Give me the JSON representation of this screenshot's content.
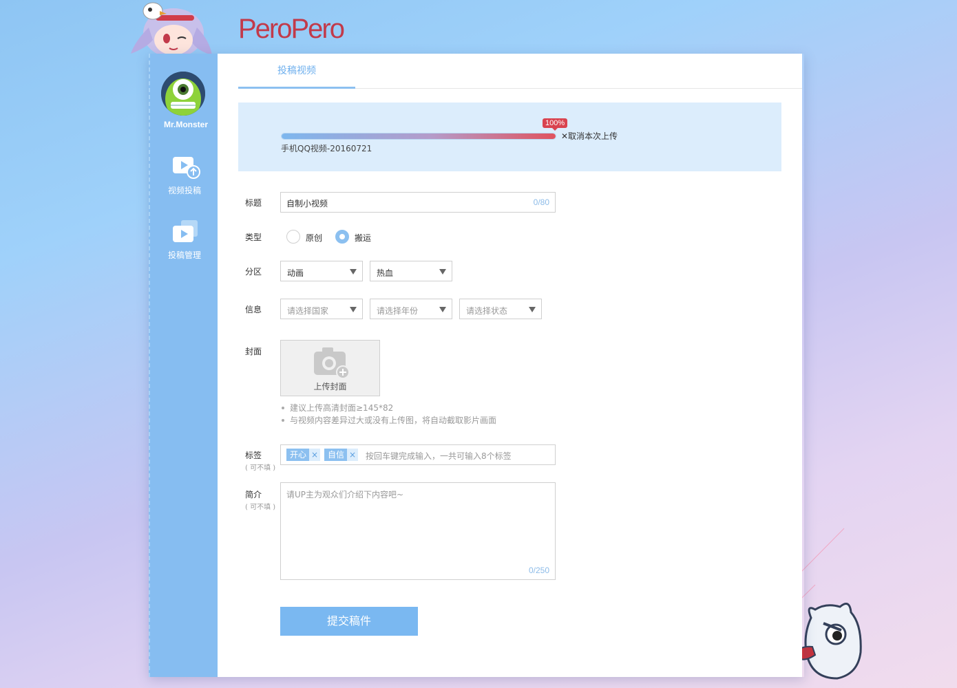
{
  "brand": {
    "logo_text_1": "Pero",
    "logo_text_2": "Pero"
  },
  "sidebar": {
    "username": "Mr.Monster",
    "items": [
      {
        "label": "视频投稿",
        "icon": "video-upload-icon"
      },
      {
        "label": "投稿管理",
        "icon": "video-manage-icon"
      }
    ]
  },
  "tabs": [
    {
      "label": "投稿视频",
      "active": true
    }
  ],
  "upload": {
    "progress": 100,
    "progress_label": "100%",
    "cancel_label": "✕取消本次上传",
    "file_name": "手机QQ视频-20160721"
  },
  "form": {
    "title": {
      "label": "标题",
      "value": "自制小视频",
      "counter": "0/80"
    },
    "type": {
      "label": "类型",
      "options": [
        "原创",
        "搬运"
      ],
      "selected": "搬运"
    },
    "zone": {
      "label": "分区",
      "primary": "动画",
      "secondary": "热血"
    },
    "info": {
      "label": "信息",
      "country": "请选择国家",
      "year": "请选择年份",
      "status": "请选择状态"
    },
    "cover": {
      "label": "封面",
      "button": "上传封面",
      "tips": [
        "建议上传高清封面≥145*82",
        "与视频内容差异过大或没有上传图，将自动截取影片画面"
      ]
    },
    "tags": {
      "label": "标签",
      "optional": "( 可不填 )",
      "items": [
        "开心",
        "自信"
      ],
      "remove_symbol": "×",
      "placeholder": "按回车键完成输入，一共可输入8个标签"
    },
    "intro": {
      "label": "简介",
      "optional": "( 可不填 )",
      "placeholder": "请UP主为观众们介绍下内容吧~",
      "counter": "0/250"
    },
    "submit_label": "提交稿件"
  },
  "colors": {
    "accent": "#7ab8f1",
    "sidebar": "#86bdf1",
    "progress_end": "#e0535f",
    "badge": "#d9434f"
  }
}
